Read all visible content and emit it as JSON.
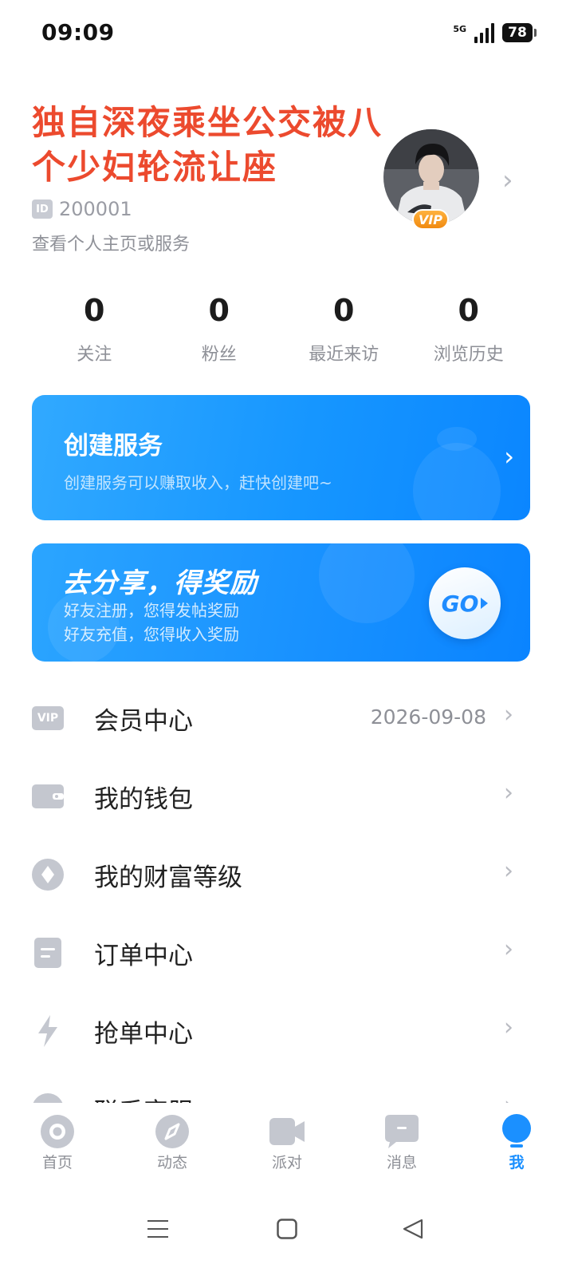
{
  "status_bar": {
    "time": "09:09",
    "network": "5G",
    "battery": "78"
  },
  "profile": {
    "nickname": "独自深夜乘坐公交被八个少妇轮流让座",
    "id_label": "ID",
    "id": "200001",
    "subtitle": "查看个人主页或服务",
    "vip_badge": "VIP",
    "arrow": "›"
  },
  "stats": [
    {
      "value": "0",
      "label": "关注"
    },
    {
      "value": "0",
      "label": "粉丝"
    },
    {
      "value": "0",
      "label": "最近来访"
    },
    {
      "value": "0",
      "label": "浏览历史"
    }
  ],
  "create_service": {
    "title": "创建服务",
    "description": "创建服务可以赚取收入，赶快创建吧~",
    "arrow": "›"
  },
  "share": {
    "title": "去分享，得奖励",
    "line1": "好友注册，您得发帖奖励",
    "line2": "好友充值，您得收入奖励",
    "go_label": "GO"
  },
  "menu": [
    {
      "label": "会员中心",
      "value": "2026-09-08",
      "icon": "vip-icon"
    },
    {
      "label": "我的钱包",
      "value": "",
      "icon": "wallet-icon"
    },
    {
      "label": "我的财富等级",
      "value": "",
      "icon": "diamond-icon"
    },
    {
      "label": "订单中心",
      "value": "",
      "icon": "order-icon"
    },
    {
      "label": "抢单中心",
      "value": "",
      "icon": "lightning-icon"
    },
    {
      "label": "联系客服",
      "value": "",
      "icon": "support-icon"
    }
  ],
  "menu_vip_icon_text": "VIP",
  "menu_arrow": "›",
  "tabs": [
    {
      "label": "首页",
      "icon": "home-icon",
      "active": false
    },
    {
      "label": "动态",
      "icon": "compass-icon",
      "active": false
    },
    {
      "label": "派对",
      "icon": "video-icon",
      "active": false
    },
    {
      "label": "消息",
      "icon": "message-icon",
      "active": false
    },
    {
      "label": "我",
      "icon": "profile-icon",
      "active": true
    }
  ],
  "colors": {
    "nickname": "#ec4a2e",
    "accent_blue": "#1b90ff",
    "icon_gray": "#c4c7cf",
    "vip_orange": "#f5a020"
  }
}
